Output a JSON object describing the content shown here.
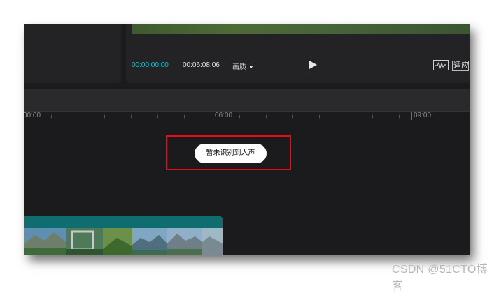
{
  "player": {
    "current_time": "00:00:00:00",
    "total_time": "00:06:08:06",
    "quality_label": "画质",
    "fit_label": "适应"
  },
  "ruler": {
    "labels": [
      "00:00",
      "06:00",
      "09:00"
    ]
  },
  "notice": {
    "text": "暂未识别到人声"
  },
  "watermark": "CSDN @51CTO博客",
  "colors": {
    "timecode_accent": "#1ec2c8",
    "highlight_box": "#e30f12",
    "clip_track": "#0f6d6f"
  }
}
